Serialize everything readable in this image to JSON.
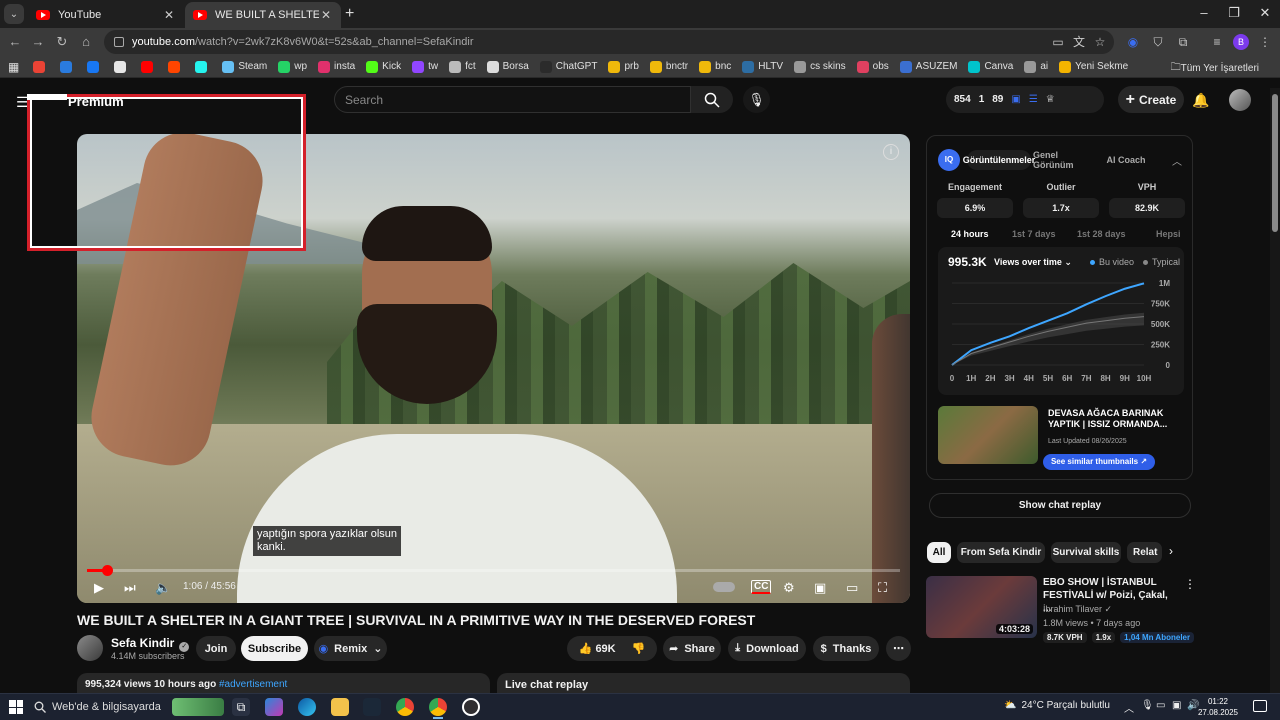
{
  "browser": {
    "tabs": [
      {
        "title": "YouTube",
        "active": false
      },
      {
        "title": "WE BUILT A SHELTER IN A GIAN",
        "active": true
      }
    ],
    "url_host": "youtube.com",
    "url_rest": "/watch?v=2wk7zK8v6W0&t=52s&ab_channel=SefaKindir",
    "bookmarks": [
      {
        "label": "",
        "color": "#ea4335"
      },
      {
        "label": "",
        "color": "#2a7bde"
      },
      {
        "label": "",
        "color": "#1877f2"
      },
      {
        "label": "",
        "color": "#e6e6e6"
      },
      {
        "label": "",
        "color": "#ff0000"
      },
      {
        "label": "",
        "color": "#ff4500"
      },
      {
        "label": "",
        "color": "#25f4ee"
      },
      {
        "label": "Steam",
        "color": "#66c0f4"
      },
      {
        "label": "wp",
        "color": "#25d366"
      },
      {
        "label": "insta",
        "color": "#e1306c"
      },
      {
        "label": "Kick",
        "color": "#53fc18"
      },
      {
        "label": "tw",
        "color": "#9146ff"
      },
      {
        "label": "fct",
        "color": "#bbbbbb"
      },
      {
        "label": "Borsa",
        "color": "#dddddd"
      },
      {
        "label": "ChatGPT",
        "color": "#2b2b2b"
      },
      {
        "label": "prb",
        "color": "#f0b90b"
      },
      {
        "label": "bnctr",
        "color": "#f0b90b"
      },
      {
        "label": "bnc",
        "color": "#f0b90b"
      },
      {
        "label": "HLTV",
        "color": "#2d6da3"
      },
      {
        "label": "cs skins",
        "color": "#999999"
      },
      {
        "label": "obs",
        "color": "#e04060"
      },
      {
        "label": "ASUZEM",
        "color": "#3b6fd1"
      },
      {
        "label": "Canva",
        "color": "#00c4cc"
      },
      {
        "label": "ai",
        "color": "#999999"
      },
      {
        "label": "Yeni Sekme",
        "color": "#f4b400"
      }
    ],
    "all_bookmarks": "Tüm Yer İşaretleri"
  },
  "masthead": {
    "premium": "Premium",
    "search_placeholder": "Search",
    "stats": [
      "854",
      "1",
      "89"
    ],
    "create": "Create"
  },
  "player": {
    "caption_line1": "yaptığın spora yazıklar olsun",
    "caption_line2": "kanki.",
    "time": "1:06 / 45:56",
    "progress": 0.024
  },
  "video": {
    "title": "WE BUILT A SHELTER IN A GIANT TREE | SURVIVAL IN A PRIMITIVE WAY IN THE DESERVED FOREST",
    "channel": "Sefa Kindir",
    "subscribers": "4.14M subscribers",
    "join": "Join",
    "subscribe": "Subscribe",
    "remix": "Remix",
    "likes": "69K",
    "share": "Share",
    "download": "Download",
    "thanks": "Thanks",
    "views_line": "995,324 views  10 hours ago",
    "hashtag": "#advertisement",
    "live_chat": "Live chat replay"
  },
  "extension": {
    "tabs": [
      "Görüntülenmeler",
      "Genel Görünüm",
      "AI Coach"
    ],
    "metrics": [
      {
        "label": "Engagement",
        "value": "6.9%"
      },
      {
        "label": "Outlier",
        "value": "1.7x"
      },
      {
        "label": "VPH",
        "value": "82.9K"
      }
    ],
    "periods": [
      "24 hours",
      "1st 7 days",
      "1st 28 days",
      "Hepsi"
    ],
    "total": "995.3K",
    "select": "Views over time",
    "legend": [
      {
        "name": "Bu video",
        "color": "#3ea6ff"
      },
      {
        "name": "Typical",
        "color": "#888888"
      }
    ],
    "related_title": "DEVASA AĞACA BARINAK YAPTIK | ISSIZ ORMANDA...",
    "related_updated": "Last Updated 08/26/2025",
    "similar_button": "See similar thumbnails"
  },
  "chart_data": {
    "type": "line",
    "x": [
      "0",
      "1H",
      "2H",
      "3H",
      "4H",
      "5H",
      "6H",
      "7H",
      "8H",
      "9H",
      "10H"
    ],
    "yticks": [
      "0",
      "250K",
      "500K",
      "750K",
      "1M"
    ],
    "ylim": [
      0,
      1000000
    ],
    "series": [
      {
        "name": "Bu video",
        "values": [
          0,
          180000,
          270000,
          350000,
          450000,
          540000,
          630000,
          740000,
          840000,
          930000,
          995300
        ]
      },
      {
        "name": "Typical",
        "values": [
          0,
          140000,
          210000,
          280000,
          350000,
          410000,
          460000,
          510000,
          540000,
          570000,
          590000
        ]
      }
    ]
  },
  "sidebar": {
    "chat_replay": "Show chat replay",
    "chips": [
      "All",
      "From Sefa Kindir",
      "Survival skills",
      "Relat"
    ],
    "rec": {
      "title": "EBO SHOW | İSTANBUL FESTİVALİ w/ Poizi, Çakal, ...",
      "channel": "İbrahim Tilaver",
      "meta": "1.8M views • 7 days ago",
      "duration": "4:03:28",
      "badges": [
        "8.7K VPH",
        "1.9x",
        "1,04 Mn Aboneler"
      ]
    }
  },
  "taskbar": {
    "search": "Web'de & bilgisayarda",
    "weather": "24°C  Parçalı bulutlu",
    "time": "01:22",
    "date": "27.08.2025"
  }
}
